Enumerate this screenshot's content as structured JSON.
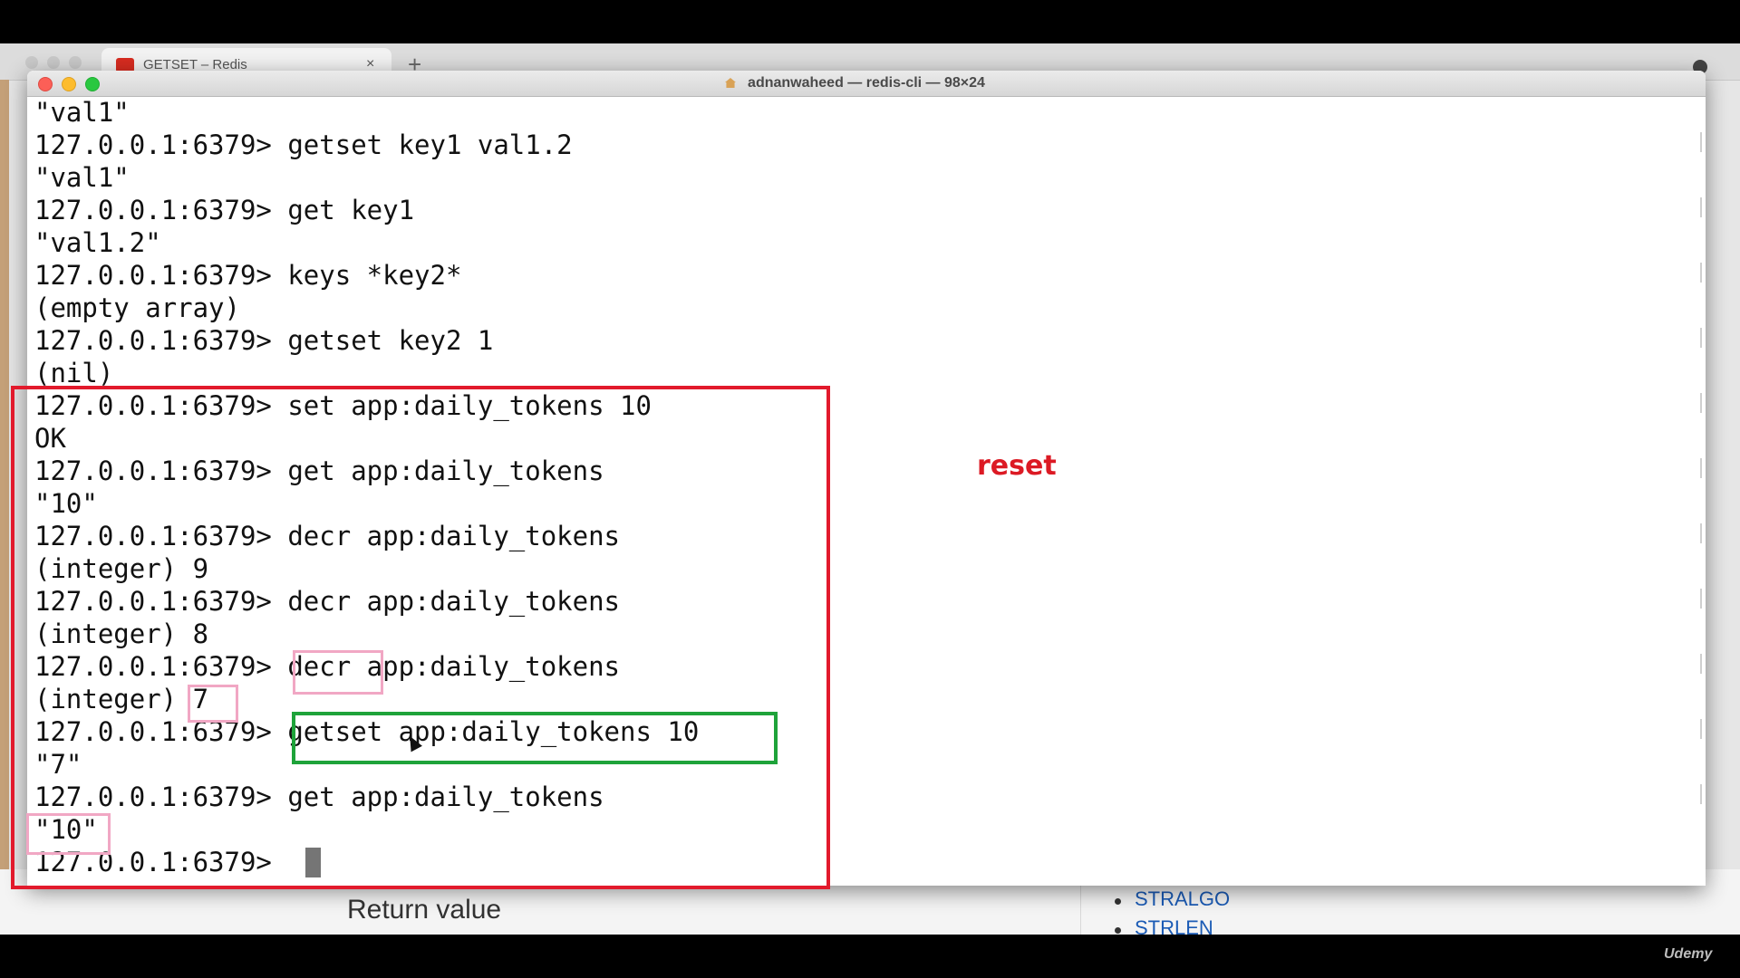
{
  "browser": {
    "tab_title": "GETSET – Redis",
    "tab_close": "×",
    "new_tab": "+"
  },
  "page": {
    "return_value_heading": "Return value",
    "sidebar_links": [
      "STRALGO",
      "STRLEN"
    ]
  },
  "terminal": {
    "title": "adnanwaheed — redis-cli — 98×24",
    "lines": [
      "\"val1\"",
      "127.0.0.1:6379> getset key1 val1.2",
      "\"val1\"",
      "127.0.0.1:6379> get key1",
      "\"val1.2\"",
      "127.0.0.1:6379> keys *key2*",
      "(empty array)",
      "127.0.0.1:6379> getset key2 1",
      "(nil)",
      "127.0.0.1:6379> set app:daily_tokens 10",
      "OK",
      "127.0.0.1:6379> get app:daily_tokens",
      "\"10\"",
      "127.0.0.1:6379> decr app:daily_tokens",
      "(integer) 9",
      "127.0.0.1:6379> decr app:daily_tokens",
      "(integer) 8",
      "127.0.0.1:6379> decr app:daily_tokens",
      "(integer) 7",
      "127.0.0.1:6379> getset app:daily_tokens 10",
      "\"7\"",
      "127.0.0.1:6379> get app:daily_tokens",
      "\"10\"",
      "127.0.0.1:6379> "
    ]
  },
  "annotation": {
    "reset_label": "reset"
  },
  "watermark": "Udemy",
  "colors": {
    "annotation_red": "#e21a2c",
    "annotation_green": "#1ea33a",
    "annotation_pink": "#f1a7c4",
    "reset_text": "#dc1a24",
    "link_blue": "#1b5bb5"
  }
}
